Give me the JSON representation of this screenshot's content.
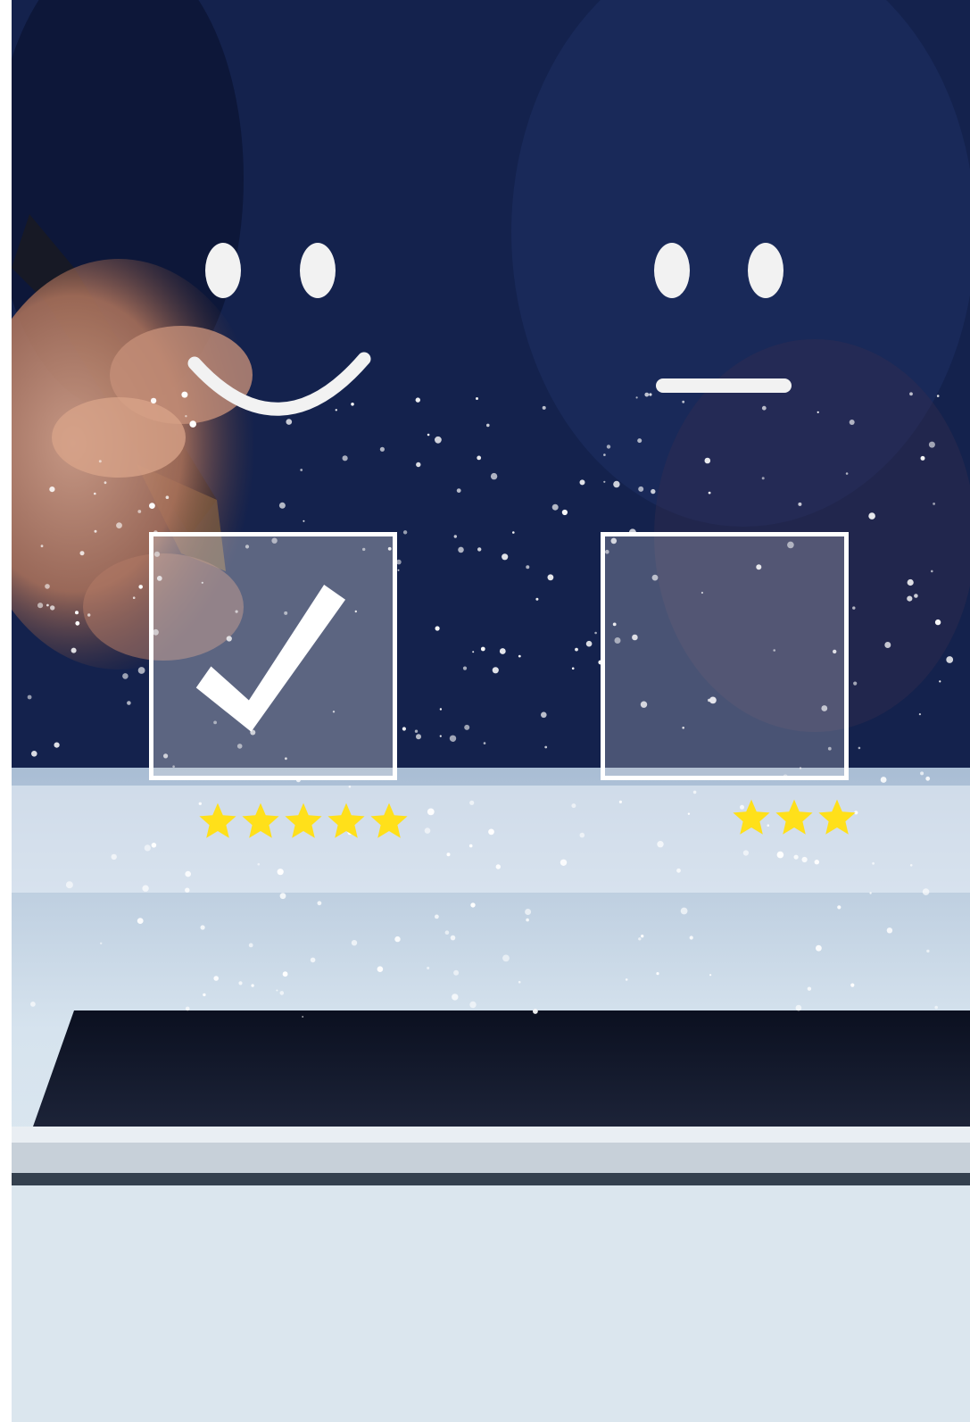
{
  "scene": {
    "description_free": true,
    "palette": {
      "background_dark": "#13214a",
      "background_light": "#dde8f0",
      "icon_white": "#f2f2f2",
      "star_yellow": "#ffe01a",
      "checkbox_fill": "rgba(210,210,215,0.38)"
    }
  },
  "rating_options": [
    {
      "face_icon": "smiley-face-icon",
      "checked": true,
      "checkbox_icon": "check-mark-icon",
      "stars": 5
    },
    {
      "face_icon": "neutral-face-icon",
      "checked": false,
      "checkbox_icon": "empty-checkbox-icon",
      "stars": 3
    }
  ]
}
